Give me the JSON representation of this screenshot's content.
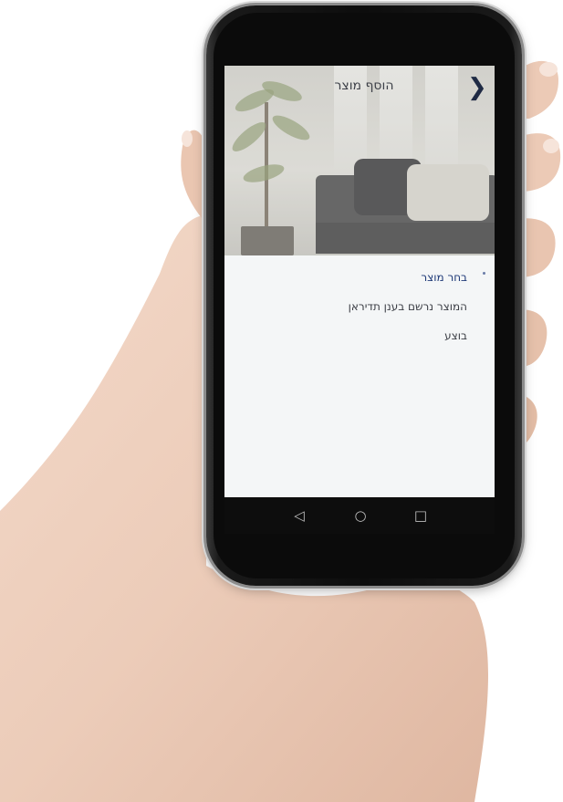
{
  "header": {
    "title": "הוסף מוצר",
    "back_icon": "chevron-right-icon"
  },
  "steps": [
    {
      "label": "בחר מוצר",
      "state": "active"
    },
    {
      "label": "המוצר נרשם בענן תדיראן",
      "state": "pending"
    },
    {
      "label": "בוצע",
      "state": "pending"
    }
  ],
  "navbar": {
    "back_icon": "triangle-back-icon",
    "home_icon": "circle-home-icon",
    "recents_icon": "square-recents-icon"
  },
  "colors": {
    "accent": "#1f3a78",
    "text": "#3b3e45",
    "background": "#f4f6f7",
    "phone": "#0d0d0d"
  }
}
